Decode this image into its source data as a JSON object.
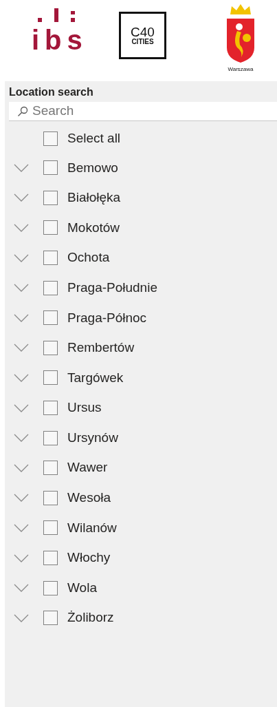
{
  "logos": {
    "ibs": "ibs",
    "c40_top": "C40",
    "c40_bottom": "CITIES",
    "city": "Warszawa"
  },
  "slicer": {
    "title": "Location search",
    "search": {
      "placeholder": "Search"
    },
    "select_all": {
      "label": "Select all",
      "checked": false
    },
    "items": [
      {
        "label": "Bemowo",
        "checked": false,
        "expanded": false
      },
      {
        "label": "Białołęka",
        "checked": false,
        "expanded": false
      },
      {
        "label": "Mokotów",
        "checked": false,
        "expanded": false
      },
      {
        "label": "Ochota",
        "checked": false,
        "expanded": false
      },
      {
        "label": "Praga-Południe",
        "checked": false,
        "expanded": false
      },
      {
        "label": "Praga-Północ",
        "checked": false,
        "expanded": false
      },
      {
        "label": "Rembertów",
        "checked": false,
        "expanded": false
      },
      {
        "label": "Targówek",
        "checked": false,
        "expanded": false
      },
      {
        "label": "Ursus",
        "checked": false,
        "expanded": false
      },
      {
        "label": "Ursynów",
        "checked": false,
        "expanded": false
      },
      {
        "label": "Wawer",
        "checked": false,
        "expanded": false
      },
      {
        "label": "Wesoła",
        "checked": false,
        "expanded": false
      },
      {
        "label": "Wilanów",
        "checked": false,
        "expanded": false
      },
      {
        "label": "Włochy",
        "checked": false,
        "expanded": false
      },
      {
        "label": "Wola",
        "checked": false,
        "expanded": false
      },
      {
        "label": "Żoliborz",
        "checked": false,
        "expanded": false
      }
    ]
  }
}
